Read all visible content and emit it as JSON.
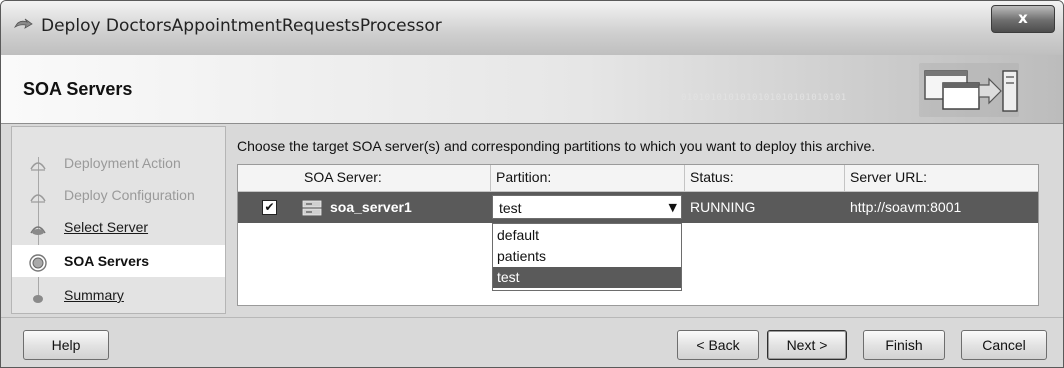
{
  "window": {
    "title": "Deploy DoctorsAppointmentRequestsProcessor",
    "close_label": "x"
  },
  "header": {
    "title": "SOA Servers",
    "binary_decoration": "0101010101010101010101010101"
  },
  "nav": {
    "items": [
      {
        "label": "Deployment Action",
        "state": "done"
      },
      {
        "label": "Deploy Configuration",
        "state": "done"
      },
      {
        "label": "Select Server",
        "state": "link"
      },
      {
        "label": "SOA Servers",
        "state": "active"
      },
      {
        "label": "Summary",
        "state": "link"
      }
    ]
  },
  "content": {
    "instructions": "Choose the target SOA server(s) and corresponding partitions to which you want to deploy this archive.",
    "table": {
      "headers": {
        "server": "SOA Server:",
        "partition": "Partition:",
        "status": "Status:",
        "url": "Server URL:"
      },
      "rows": [
        {
          "checked": true,
          "server": "soa_server1",
          "partition": "test",
          "status": "RUNNING",
          "url": "http://soavm:8001"
        }
      ]
    },
    "partition_options": [
      {
        "label": "default",
        "selected": false
      },
      {
        "label": "patients",
        "selected": false
      },
      {
        "label": "test",
        "selected": true
      }
    ]
  },
  "footer": {
    "help": "Help",
    "back": "< Back",
    "next": "Next >",
    "finish": "Finish",
    "cancel": "Cancel"
  },
  "colors": {
    "selected_row": "#5a5a5a",
    "dialog_bg": "#d9d9d9"
  }
}
